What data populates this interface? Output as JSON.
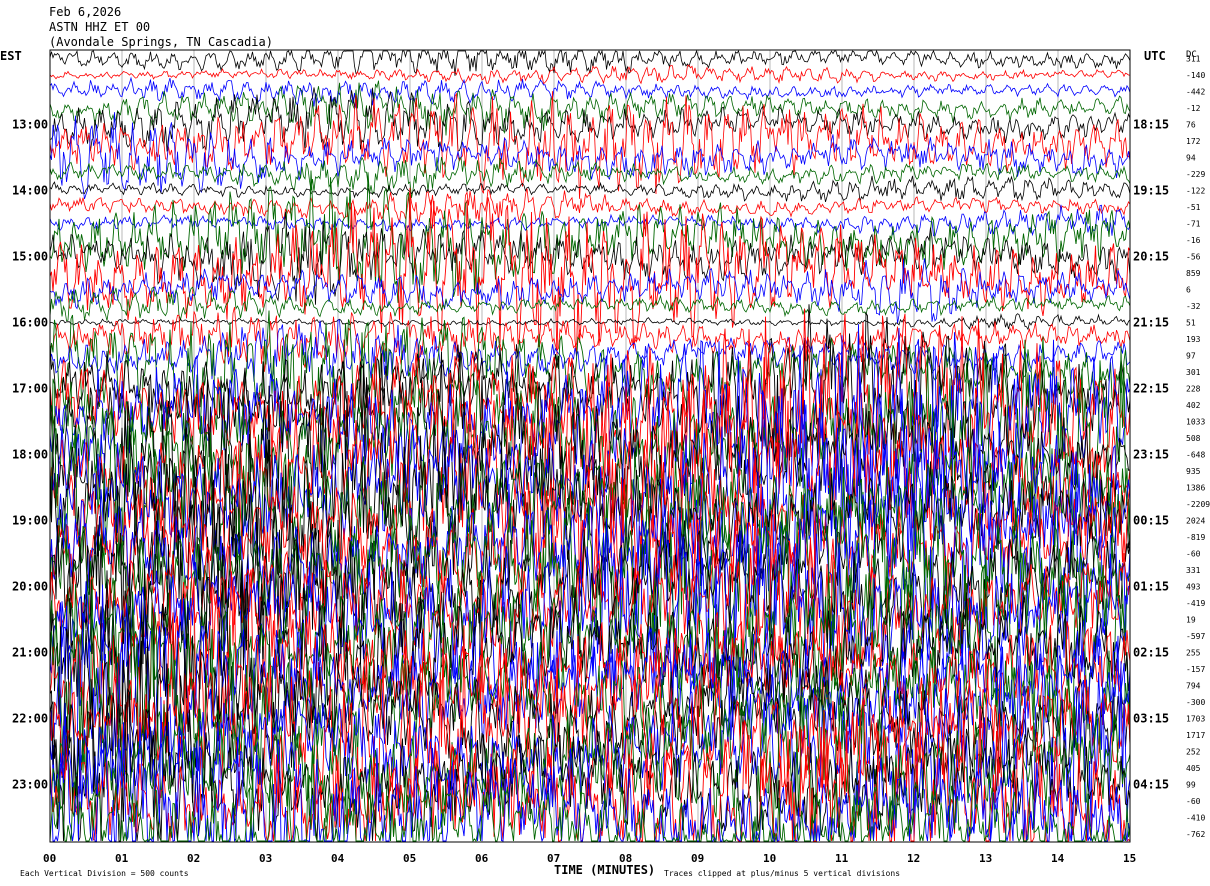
{
  "header": {
    "date": "Feb 6,2026",
    "station": "ASTN HHZ ET 00",
    "location": "(Avondale Springs, TN Cascadia)"
  },
  "axes": {
    "left_zone": "EST",
    "right_zone": "UTC",
    "dc_label": "DC",
    "x_label": "TIME (MINUTES)",
    "footer_left": "Each Vertical Division = 500 counts",
    "footer_right": "Traces clipped at plus/minus 5 vertical divisions"
  },
  "colors": {
    "trace_cycle": [
      "#000000",
      "#ff0000",
      "#0000ff",
      "#006600"
    ],
    "grid": "#888888"
  },
  "chart_data": {
    "type": "line",
    "title": "ASTN HHZ ET 00",
    "xlabel": "TIME (MINUTES)",
    "xlim": [
      0,
      15
    ],
    "x_ticks": [
      "00",
      "01",
      "02",
      "03",
      "04",
      "05",
      "06",
      "07",
      "08",
      "09",
      "10",
      "11",
      "12",
      "13",
      "14",
      "15"
    ],
    "trace_minutes": 15,
    "traces_per_hour": 4,
    "left_hour_labels": [
      "13:00",
      "14:00",
      "15:00",
      "16:00",
      "17:00",
      "18:00",
      "19:00",
      "20:00",
      "21:00",
      "22:00",
      "23:00"
    ],
    "right_hour_labels": [
      "18:15",
      "19:15",
      "20:15",
      "21:15",
      "22:15",
      "23:15",
      "00:15",
      "01:15",
      "02:15",
      "03:15",
      "04:15"
    ],
    "dc_offsets": [
      "311",
      "-140",
      "-442",
      "-12",
      "76",
      "172",
      "94",
      "-229",
      "-122",
      "-51",
      "-71",
      "-16",
      "-56",
      "859",
      "6",
      "-32",
      "51",
      "193",
      "97",
      "301",
      "228",
      "402",
      "1033",
      "508",
      "-648",
      "935",
      "1386",
      "-2209",
      "2024",
      "-819",
      "-60",
      "331",
      "493",
      "-419",
      "19",
      "-597",
      "255",
      "-157",
      "794",
      "-300",
      "1703",
      "1717",
      "252",
      "405",
      "99",
      "-60",
      "-410",
      "-762"
    ],
    "trace_amplitude_level": [
      1.3,
      0.6,
      0.9,
      1.6,
      2.1,
      3.4,
      2.6,
      1.4,
      0.9,
      1.2,
      1.0,
      4.2,
      3.2,
      5.2,
      2.4,
      1.2,
      0.5,
      1.9,
      2.2,
      4.2,
      5,
      6,
      7,
      7,
      7,
      7,
      7,
      7,
      7,
      7,
      7,
      7,
      7,
      7,
      7,
      7,
      7,
      7,
      7,
      7,
      7,
      7,
      7,
      7,
      7,
      7,
      7,
      7
    ]
  }
}
